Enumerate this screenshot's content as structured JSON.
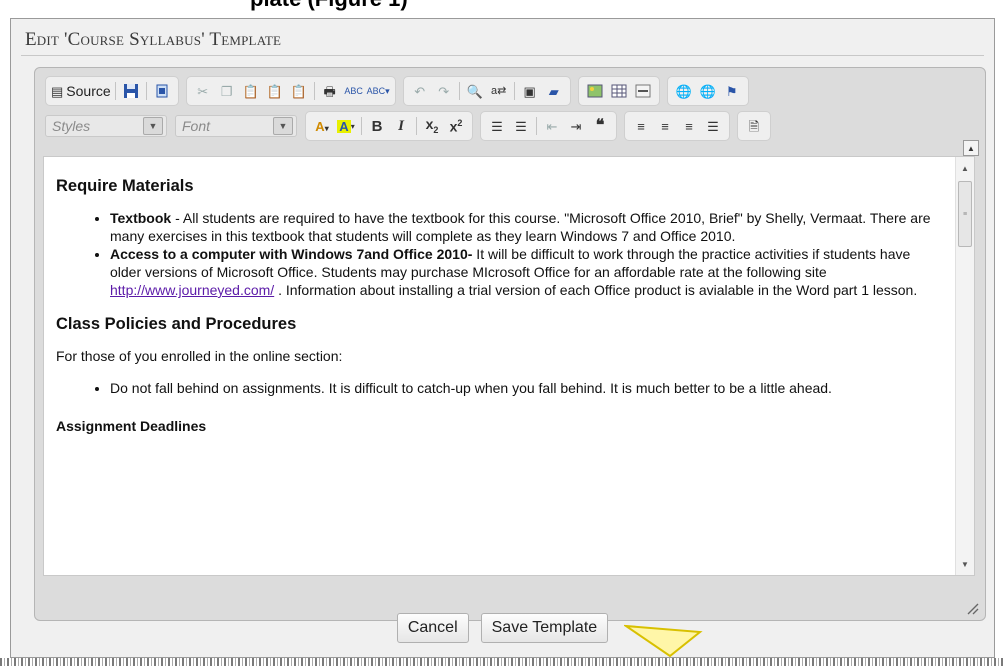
{
  "header_cut": "plate (Figure 1)",
  "dialog": {
    "title": "Edit 'Course Syllabus' Template"
  },
  "toolbar": {
    "source_label": "Source",
    "styles_placeholder": "Styles",
    "font_placeholder": "Font",
    "bold": "B",
    "italic": "I"
  },
  "document": {
    "h1": "Require Materials",
    "items": [
      {
        "bold": "Textbook",
        "text": " - All students are required to have the textbook for this course. \"Microsoft Office 2010, Brief\" by Shelly, Vermaat. There are many exercises in this textbook that students will complete as they learn Windows 7 and Office 2010."
      },
      {
        "bold": "Access to a computer with Windows 7and Office 2010-",
        "text_before_link": "  It will be difficult to work through the practice activities if students have older versions of Microsoft Office. Students may purchase MIcrosoft Office for an affordable rate at the following site ",
        "link": "http://www.journeyed.com/",
        "text_after_link": " . Information about installing a trial version of each Office product is avialable in the Word part 1 lesson."
      }
    ],
    "h2": "Class Policies and Procedures",
    "para": "For those of you enrolled in the online section:",
    "bullet": "Do not fall behind on assignments. It is difficult to catch-up when you fall behind. It is much better to be a little ahead.",
    "h3": "Assignment Deadlines"
  },
  "buttons": {
    "cancel": "Cancel",
    "save": "Save Template"
  }
}
